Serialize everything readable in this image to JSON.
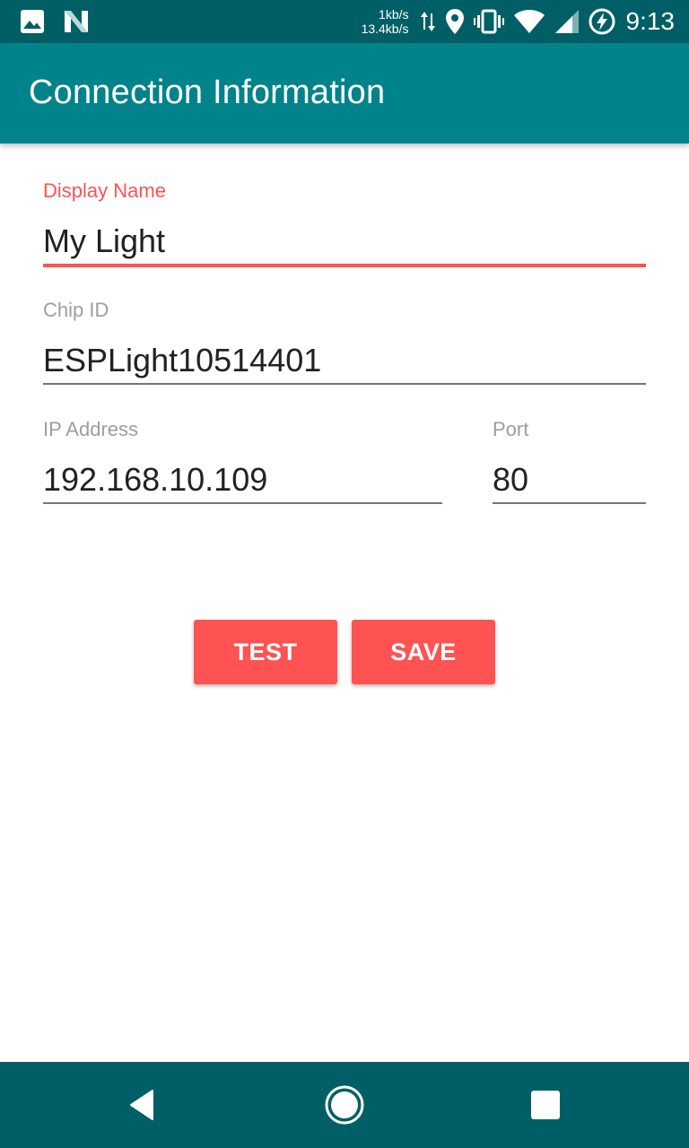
{
  "status_bar": {
    "upload_speed": "1kb/s",
    "download_speed": "13.4kb/s",
    "time": "9:13",
    "icons": [
      "image-icon",
      "n-logo-icon",
      "data-arrows-icon",
      "location-icon",
      "vibrate-icon",
      "wifi-icon",
      "cell-signal-icon",
      "battery-charging-icon"
    ]
  },
  "app_bar": {
    "title": "Connection Information"
  },
  "form": {
    "display_name": {
      "label": "Display Name",
      "value": "My Light"
    },
    "chip_id": {
      "label": "Chip ID",
      "value": "ESPLight10514401"
    },
    "ip_address": {
      "label": "IP Address",
      "value": "192.168.10.109"
    },
    "port": {
      "label": "Port",
      "value": "80"
    }
  },
  "buttons": {
    "test_label": "TEST",
    "save_label": "SAVE"
  },
  "nav_bar": {
    "icons": [
      "back-icon",
      "home-icon",
      "recents-icon"
    ]
  },
  "colors": {
    "status_bar": "#005f66",
    "app_bar": "#00838a",
    "accent": "#ff5252",
    "nav_bar": "#005f66"
  }
}
